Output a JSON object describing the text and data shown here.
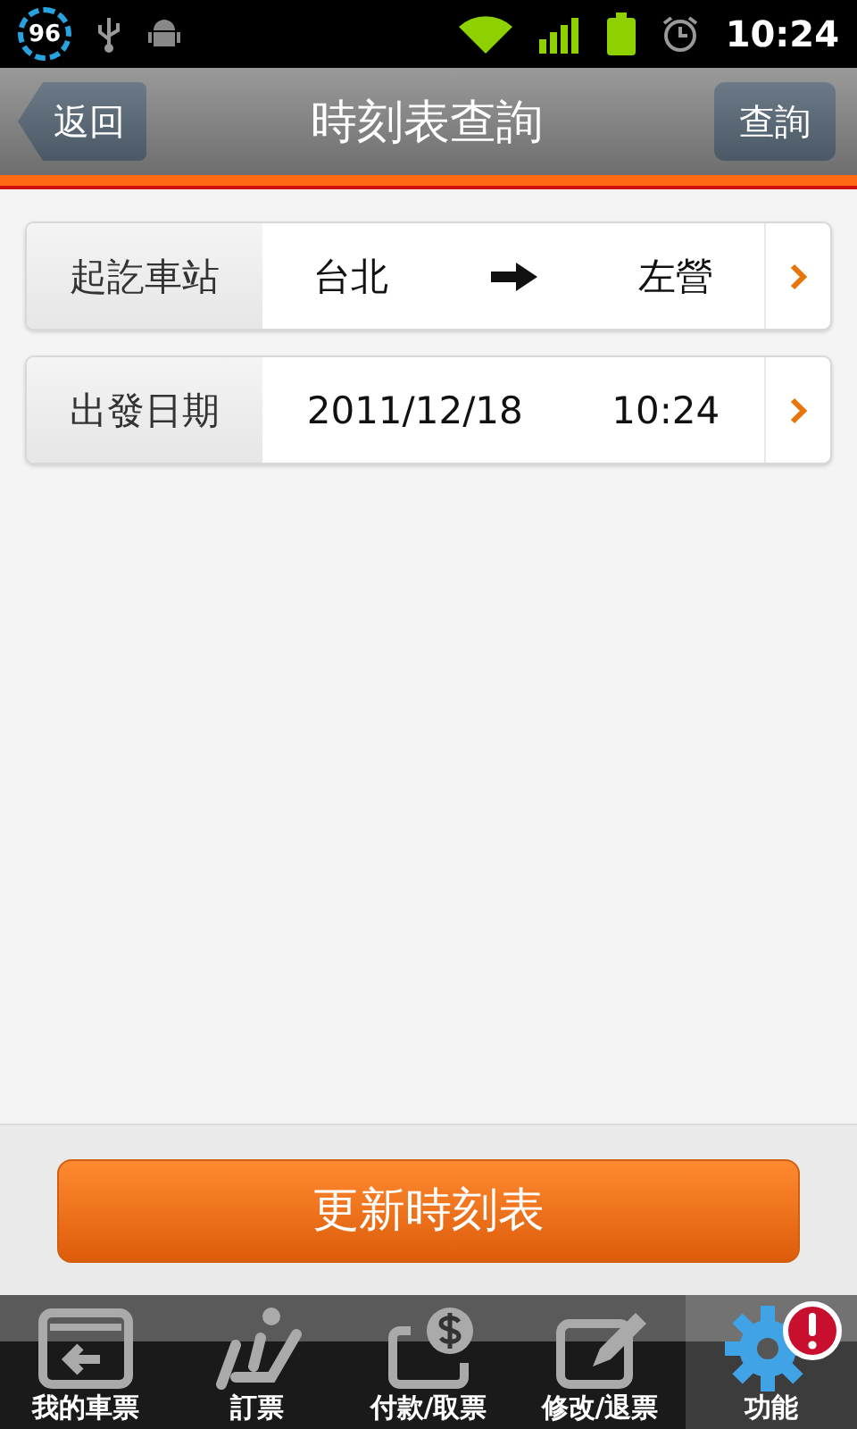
{
  "status_bar": {
    "battery": "96",
    "time": "10:24"
  },
  "header": {
    "back": "返回",
    "title": "時刻表查詢",
    "action": "查詢"
  },
  "rows": [
    {
      "kind": "stations",
      "label": "起訖車站",
      "from": "台北",
      "to": "左營"
    },
    {
      "kind": "datetime",
      "label": "出發日期",
      "date": "2011/12/18",
      "time": "10:24"
    }
  ],
  "update_button": "更新時刻表",
  "tabs": [
    {
      "kind": "ticket",
      "label": "我的車票",
      "selected": false,
      "alert": false
    },
    {
      "kind": "seat",
      "label": "訂票",
      "selected": false,
      "alert": false
    },
    {
      "kind": "pay",
      "label": "付款/取票",
      "selected": false,
      "alert": false
    },
    {
      "kind": "edit",
      "label": "修改/退票",
      "selected": false,
      "alert": false
    },
    {
      "kind": "gear",
      "label": "功能",
      "selected": true,
      "alert": true
    }
  ]
}
